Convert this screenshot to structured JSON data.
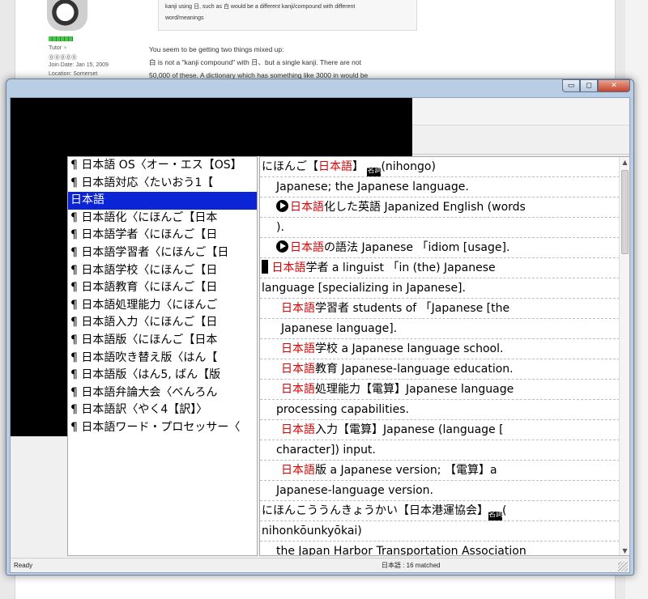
{
  "forum": {
    "quote_line1": "kanji using 日, such as 白 would be a different kanji/compound with different",
    "quote_line2": "word/meanings",
    "user_title": "Tutor ♀",
    "user_badges": "⓪⓪⓪⓪⓪",
    "join_date": "Join Date: Jan 15, 2009",
    "location": "Location: Somerset",
    "post_line1": "You seem to be getting two things mixed up:",
    "post_line2": "白 is not a \"kanji compound\" with 日、but a single kanji. There are not",
    "post_line3": "50,000 of these. A dictionary which has something like 3000 in would be"
  },
  "window": {
    "min_label": "▭",
    "max_label": "◻",
    "close_label": "✕"
  },
  "word_list": {
    "items": [
      "¶ 日本語 OS〈オー・エス【OS】",
      "¶ 日本語対応〈たいおう1【",
      "日本語",
      "¶ 日本語化〈にほんご【日本",
      "¶ 日本語学者〈にほんご【日",
      "¶ 日本語学習者〈にほんご【日",
      "¶ 日本語学校〈にほんご【日",
      "¶ 日本語教育〈にほんご【日",
      "¶ 日本語処理能力〈にほんご",
      "¶ 日本語入力〈にほんご【日",
      "¶ 日本語版〈にほんご【日本",
      "¶ 日本語吹き替え版〈はん【",
      "¶ 日本語版〈はん5, ばん【版",
      "¶ 日本語弁論大会〈べんろん",
      "¶ 日本語訳〈やく4【訳】〉",
      "¶ 日本語ワード・プロセッサー〈"
    ],
    "selected_index": 2
  },
  "definitions": {
    "l1_a": "にほんご【",
    "l1_red": "日本語",
    "l1_b": "】",
    "l1_badge": "名詞",
    "l1_c": "(nihongo)",
    "l2": "Japanese; the Japanese language.",
    "l3_red": "日本語",
    "l3_b": "化した英語 Japanized English (words",
    "l4": ").",
    "l5_red": "日本語",
    "l5_b": "の語法 Japanese 「idiom [usage].",
    "l6_red": "日本語",
    "l6_b": "学者 a linguist 「in (the) Japanese",
    "l7": "language [specializing in Japanese].",
    "l8_red": "日本語",
    "l8_b": "学習者 students of 「Japanese [the",
    "l9": "Japanese language].",
    "l10_red": "日本語",
    "l10_b": "学校 a Japanese language school.",
    "l11_red": "日本語",
    "l11_b": "教育 Japanese-language education.",
    "l12_red": "日本語",
    "l12_b": "処理能力【電算】Japanese language",
    "l13": "processing capabilities.",
    "l14_red": "日本語",
    "l14_b": "入力【電算】Japanese (language [",
    "l15": "character]) input.",
    "l16_red": "日本語",
    "l16_b": "版 a Japanese version; 【電算】a",
    "l17": "Japanese-language version.",
    "l18_a": "にほんこううんきょうかい【日本港運協会】",
    "l18_badge": "名詞",
    "l18_c": "(",
    "l19": "nihonkōunkyōkai)",
    "l20": "the Japan Harbor Transportation Association"
  },
  "status": {
    "left": "Ready",
    "middle": "日本語 : 16 matched"
  },
  "colors": {
    "selection": "#0a24d6",
    "highlight_red": "#e00000"
  }
}
